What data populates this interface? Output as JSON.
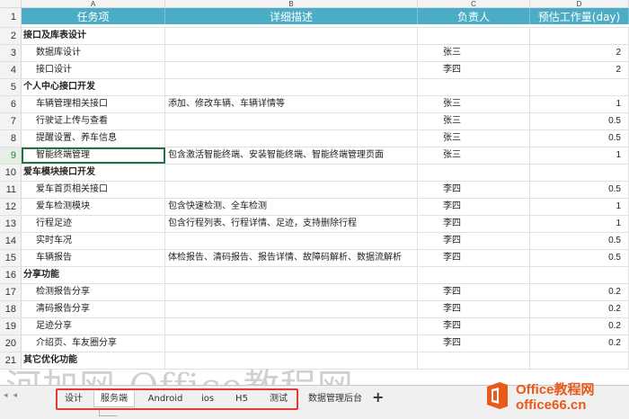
{
  "columns": {
    "A": "A",
    "B": "B",
    "C": "C",
    "D": "D"
  },
  "header": {
    "row_number": "1",
    "task": "任务项",
    "description": "详细描述",
    "owner": "负责人",
    "estimate": "预估工作量(day)"
  },
  "rows": [
    {
      "n": "2",
      "a": "接口及库表设计",
      "b": "",
      "c": "",
      "d": "",
      "kind": "sect"
    },
    {
      "n": "3",
      "a": "数据库设计",
      "b": "",
      "c": "张三",
      "d": "2",
      "kind": "sub"
    },
    {
      "n": "4",
      "a": "接口设计",
      "b": "",
      "c": "李四",
      "d": "2",
      "kind": "sub"
    },
    {
      "n": "5",
      "a": "个人中心接口开发",
      "b": "",
      "c": "",
      "d": "",
      "kind": "sect"
    },
    {
      "n": "6",
      "a": "车辆管理相关接口",
      "b": "添加、修改车辆、车辆详情等",
      "c": "张三",
      "d": "1",
      "kind": "sub"
    },
    {
      "n": "7",
      "a": "行驶证上传与查看",
      "b": "",
      "c": "张三",
      "d": "0.5",
      "kind": "sub"
    },
    {
      "n": "8",
      "a": "提醒设置、养车信息",
      "b": "",
      "c": "张三",
      "d": "0.5",
      "kind": "sub"
    },
    {
      "n": "9",
      "a": "智能终端管理",
      "b": "包含激活智能终端、安装智能终端、智能终端管理页面",
      "c": "张三",
      "d": "1",
      "kind": "sub",
      "selected": true
    },
    {
      "n": "10",
      "a": "爱车模块接口开发",
      "b": "",
      "c": "",
      "d": "",
      "kind": "sect"
    },
    {
      "n": "11",
      "a": "爱车首页相关接口",
      "b": "",
      "c": "李四",
      "d": "0.5",
      "kind": "sub"
    },
    {
      "n": "12",
      "a": "爱车检测模块",
      "b": "包含快速检测、全车检测",
      "c": "李四",
      "d": "1",
      "kind": "sub"
    },
    {
      "n": "13",
      "a": "行程足迹",
      "b": "包含行程列表、行程详情、足迹，支持删除行程",
      "c": "李四",
      "d": "1",
      "kind": "sub"
    },
    {
      "n": "14",
      "a": "实时车况",
      "b": "",
      "c": "李四",
      "d": "0.5",
      "kind": "sub"
    },
    {
      "n": "15",
      "a": "车辆报告",
      "b": "体检报告、清码报告、报告详情、故障码解析、数据流解析",
      "c": "李四",
      "d": "0.5",
      "kind": "sub"
    },
    {
      "n": "16",
      "a": "分享功能",
      "b": "",
      "c": "",
      "d": "",
      "kind": "sect"
    },
    {
      "n": "17",
      "a": "检测报告分享",
      "b": "",
      "c": "李四",
      "d": "0.2",
      "kind": "sub"
    },
    {
      "n": "18",
      "a": "清码报告分享",
      "b": "",
      "c": "李四",
      "d": "0.2",
      "kind": "sub"
    },
    {
      "n": "19",
      "a": "足迹分享",
      "b": "",
      "c": "李四",
      "d": "0.2",
      "kind": "sub"
    },
    {
      "n": "20",
      "a": "介绍页、车友圈分享",
      "b": "",
      "c": "李四",
      "d": "0.2",
      "kind": "sub"
    },
    {
      "n": "21",
      "a": "其它优化功能",
      "b": "",
      "c": "",
      "d": "",
      "kind": "sect"
    }
  ],
  "sheet_tabs": [
    "设计",
    "服务端",
    "Android",
    "ios",
    "H5",
    "测试",
    "数据管理后台"
  ],
  "active_tab": "服务端",
  "add_tab": "+",
  "watermark": "河加网-Office教程网",
  "logo": {
    "line1": "Office教程网",
    "line2": "office66.cn"
  },
  "colors": {
    "header_bg": "#4bacc6",
    "highlight_box": "#e53935",
    "logo": "#e8591a"
  }
}
